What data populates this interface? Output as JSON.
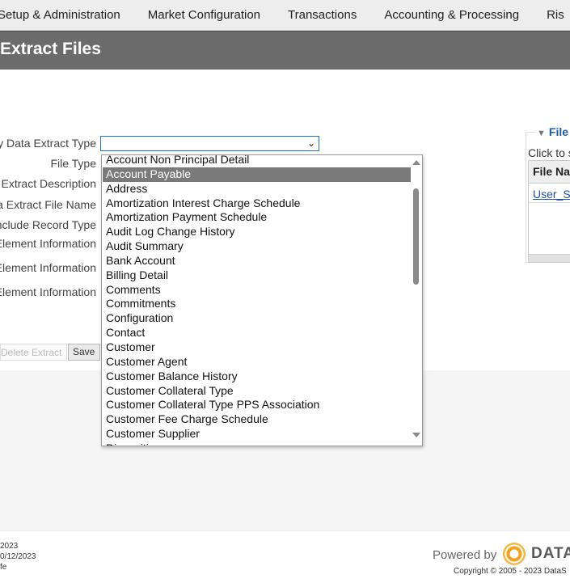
{
  "nav": {
    "items": [
      "Setup & Administration",
      "Market Configuration",
      "Transactions",
      "Accounting & Processing",
      "Ris"
    ]
  },
  "page_title": "Extract Files",
  "form": {
    "labels": [
      "y Data Extract Type",
      "File Type",
      "Extract Description",
      "a Extract File Name",
      "nclude Record Type",
      "Element Information",
      "Element Information",
      "Element Information"
    ],
    "select_value": ""
  },
  "buttons": {
    "delete": "Delete Extract",
    "save": "Save"
  },
  "dropdown": {
    "selected": "Account Payable",
    "options": [
      "Account Non Principal Detail",
      "Account Payable",
      "Address",
      "Amortization Interest Charge Schedule",
      "Amortization Payment Schedule",
      "Audit Log Change History",
      "Audit Summary",
      "Bank Account",
      "Billing Detail",
      "Comments",
      "Commitments",
      "Configuration",
      "Contact",
      "Customer",
      "Customer Agent",
      "Customer Balance History",
      "Customer Collateral Type",
      "Customer Collateral Type PPS Association",
      "Customer Fee Charge Schedule",
      "Customer Supplier",
      "Disposition"
    ]
  },
  "files_panel": {
    "legend": "File",
    "hint": "Click to s",
    "column_header": "File Na",
    "rows": [
      "User_S"
    ]
  },
  "footer": {
    "info": [
      "2023",
      "0/12/2023",
      "fe"
    ],
    "powered_by": "Powered by",
    "brand": "DATA",
    "copyright": "Copyright © 2005 - 2023 DataS"
  },
  "colors": {
    "accent": "#1b5ca8",
    "title_bar": "#6b6b6b",
    "logo": "#f3a21f"
  }
}
